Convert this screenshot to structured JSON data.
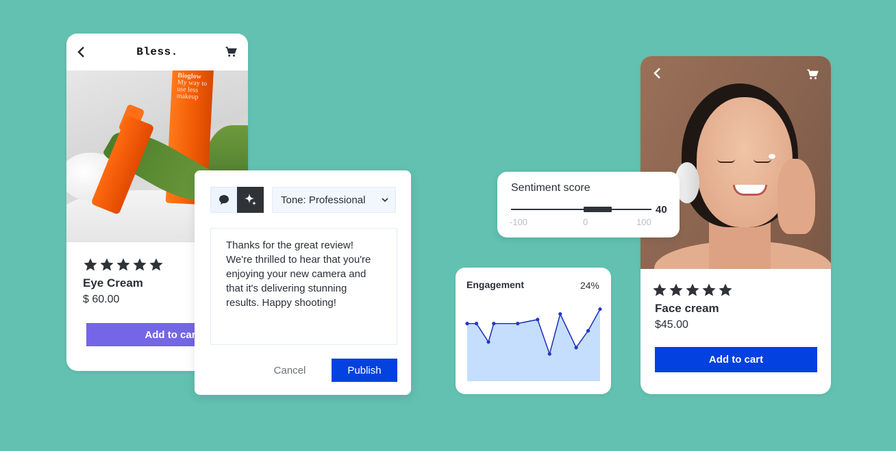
{
  "colors": {
    "background": "#62c1b1",
    "purple_button": "#7466e6",
    "blue_button": "#0341e0",
    "dark": "#2f3338",
    "chart_line": "#2436c0",
    "chart_fill": "#c5defd"
  },
  "left_product": {
    "brand": "Bless.",
    "back_icon": "chevron-left-icon",
    "cart_icon": "cart-icon",
    "photo_label": "Bioglow",
    "photo_tagline": "My way to use less makeup",
    "rating": 5,
    "rating_max": 5,
    "name": "Eye Cream",
    "price": "$ 60.00",
    "add_to_cart": "Add to cart"
  },
  "reply_composer": {
    "mode_icons": [
      "speech-bubble-icon",
      "sparkles-icon"
    ],
    "active_mode": "sparkles-icon",
    "tone_label": "Tone: Professional",
    "message": "Thanks for the great review!\nWe're thrilled to hear that you're\nenjoying your new camera and\nthat it's delivering stunning\nresults. Happy shooting!",
    "cancel_label": "Cancel",
    "publish_label": "Publish"
  },
  "sentiment": {
    "title": "Sentiment score",
    "value": "40",
    "min": -100,
    "max": 100,
    "range_start": 0,
    "range_end": 40,
    "ticks": [
      "-100",
      "0",
      "100"
    ]
  },
  "engagement": {
    "title": "Engagement",
    "value": "24%"
  },
  "right_product": {
    "back_icon": "chevron-left-icon",
    "cart_icon": "cart-icon",
    "rating": 5,
    "rating_max": 5,
    "name": "Face cream",
    "price": "$45.00",
    "add_to_cart": "Add to cart"
  },
  "chart_data": {
    "type": "area",
    "title": "Engagement",
    "xlabel": "",
    "ylabel": "",
    "x": [
      0,
      7,
      16,
      20,
      38,
      53,
      62,
      70,
      82,
      91,
      100
    ],
    "values": [
      72,
      72,
      49,
      72,
      72,
      77,
      34,
      84,
      42,
      63,
      90
    ],
    "xlim": [
      0,
      100
    ],
    "ylim": [
      0,
      100
    ],
    "grid": false,
    "legend": "none"
  }
}
